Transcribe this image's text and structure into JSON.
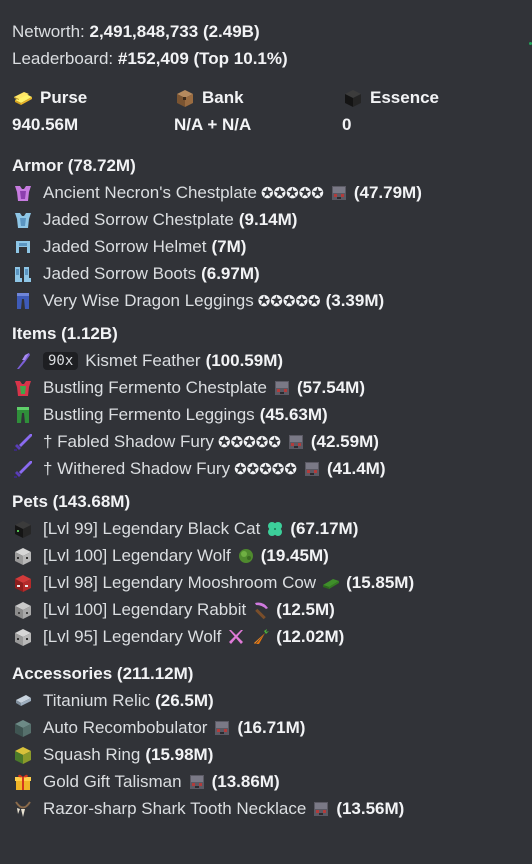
{
  "stats": {
    "networth_label": "Networth:",
    "networth_value": "2,491,848,733",
    "networth_short": "(2.49B)",
    "leaderboard_label": "Leaderboard:",
    "leaderboard_value": "#152,409",
    "leaderboard_top": "(Top 10.1%)"
  },
  "balances": [
    {
      "label": "Purse",
      "value": "940.56M",
      "icon": "gold-ingot-icon"
    },
    {
      "label": "Bank",
      "value": "N/A + N/A",
      "icon": "bank-chest-icon"
    },
    {
      "label": "Essence",
      "value": "0",
      "icon": "essence-block-icon"
    }
  ],
  "sections": {
    "armor": {
      "title": "Armor (78.72M)",
      "items": [
        {
          "name": "Ancient Necron's Chestplate",
          "stars": "✪✪✪✪✪",
          "value": "(47.79M)",
          "icon": "chestplate-icon"
        },
        {
          "name": "Jaded Sorrow Chestplate",
          "value": "(9.14M)",
          "icon": "chestplate-icon"
        },
        {
          "name": "Jaded Sorrow Helmet",
          "value": "(7M)",
          "icon": "helmet-icon"
        },
        {
          "name": "Jaded Sorrow Boots",
          "value": "(6.97M)",
          "icon": "boots-icon"
        },
        {
          "name": "Very Wise Dragon Leggings",
          "stars": "✪✪✪✪✪",
          "value": "(3.39M)",
          "icon": "leggings-icon"
        }
      ]
    },
    "items": {
      "title": "Items (1.12B)",
      "items": [
        {
          "qty": "90x",
          "name": "Kismet Feather",
          "value": "(100.59M)",
          "icon": "feather-icon"
        },
        {
          "name": "Bustling Fermento Chestplate",
          "value": "(57.54M)",
          "icon": "chestplate-icon"
        },
        {
          "name": "Bustling Fermento Leggings",
          "value": "(45.63M)",
          "icon": "leggings-icon"
        },
        {
          "name": "† Fabled Shadow Fury",
          "stars": "✪✪✪✪✪",
          "value": "(42.59M)",
          "icon": "sword-icon"
        },
        {
          "name": "† Withered Shadow Fury",
          "stars": "✪✪✪✪✪",
          "value": "(41.4M)",
          "icon": "sword-icon"
        }
      ]
    },
    "pets": {
      "title": "Pets (143.68M)",
      "items": [
        {
          "name": "[Lvl 99] Legendary Black Cat",
          "value": "(67.17M)",
          "icon": "pet-head-icon"
        },
        {
          "name": "[Lvl 100] Legendary Wolf",
          "value": "(19.45M)",
          "icon": "pet-head-icon"
        },
        {
          "name": "[Lvl 98] Legendary Mooshroom Cow",
          "value": "(15.85M)",
          "icon": "pet-head-icon"
        },
        {
          "name": "[Lvl 100] Legendary Rabbit",
          "value": "(12.5M)",
          "icon": "pet-head-icon"
        },
        {
          "name": "[Lvl 95] Legendary Wolf",
          "value": "(12.02M)",
          "icon": "pet-head-icon"
        }
      ]
    },
    "accessories": {
      "title": "Accessories (211.12M)",
      "items": [
        {
          "name": "Titanium Relic",
          "value": "(26.5M)",
          "icon": "relic-icon"
        },
        {
          "name": "Auto Recombobulator",
          "value": "(16.71M)",
          "icon": "skull-icon"
        },
        {
          "name": "Squash Ring",
          "value": "(15.98M)",
          "icon": "ring-icon"
        },
        {
          "name": "Gold Gift Talisman",
          "value": "(13.86M)",
          "icon": "gift-icon"
        },
        {
          "name": "Razor-sharp Shark Tooth Necklace",
          "value": "(13.56M)",
          "icon": "necklace-icon"
        }
      ]
    }
  },
  "colors": {
    "background": "#313338",
    "text": "#dbdee1",
    "bold_text": "#f2f3f5",
    "code_bg": "#1e1f22"
  }
}
